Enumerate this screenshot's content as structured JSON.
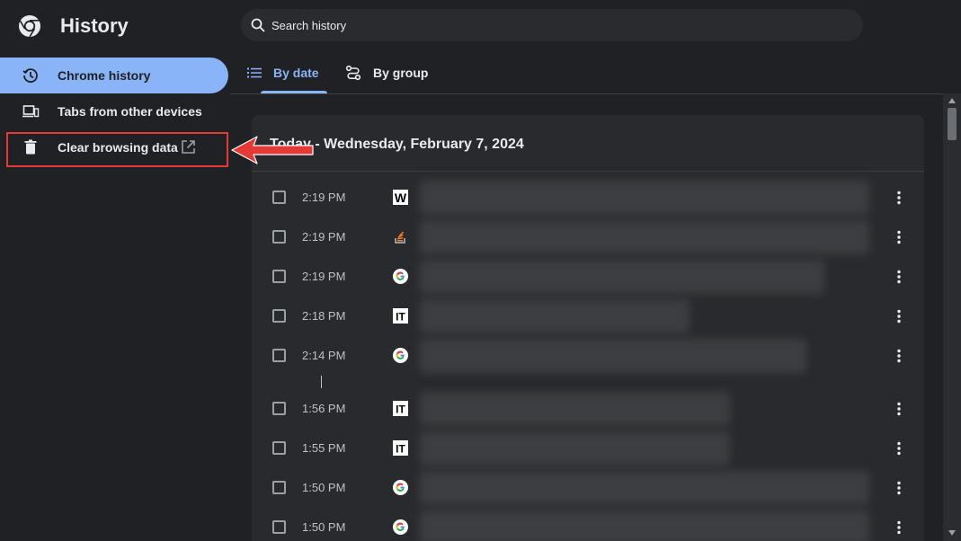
{
  "app": {
    "title": "History",
    "logo_icon": "chrome-logo-icon"
  },
  "search": {
    "placeholder": "Search history",
    "value": ""
  },
  "sidebar": {
    "items": [
      {
        "label": "Chrome history",
        "icon": "history-clock-icon",
        "active": true
      },
      {
        "label": "Tabs from other devices",
        "icon": "devices-icon",
        "active": false
      },
      {
        "label": "Clear browsing data",
        "icon": "trash-icon",
        "trailing_icon": "open-in-new-icon",
        "active": false
      }
    ]
  },
  "tabs": [
    {
      "label": "By date",
      "icon": "list-icon",
      "selected": true
    },
    {
      "label": "By group",
      "icon": "route-icon",
      "selected": false
    }
  ],
  "history": {
    "date_heading": "Today - Wednesday, February 7, 2024",
    "entries": [
      {
        "time": "2:19 PM",
        "favicon": "w-site-icon"
      },
      {
        "time": "2:19 PM",
        "favicon": "stack-overflow-icon"
      },
      {
        "time": "2:19 PM",
        "favicon": "google-icon"
      },
      {
        "time": "2:18 PM",
        "favicon": "it-site-icon"
      },
      {
        "time": "2:14 PM",
        "favicon": "google-icon"
      },
      {
        "time": "1:56 PM",
        "favicon": "it-site-icon"
      },
      {
        "time": "1:55 PM",
        "favicon": "it-site-icon"
      },
      {
        "time": "1:50 PM",
        "favicon": "google-icon"
      },
      {
        "time": "1:50 PM",
        "favicon": "google-icon"
      }
    ]
  },
  "colors": {
    "background": "#202124",
    "accent": "#8ab4f8",
    "card": "#292a2d",
    "highlight": "#e53935"
  }
}
